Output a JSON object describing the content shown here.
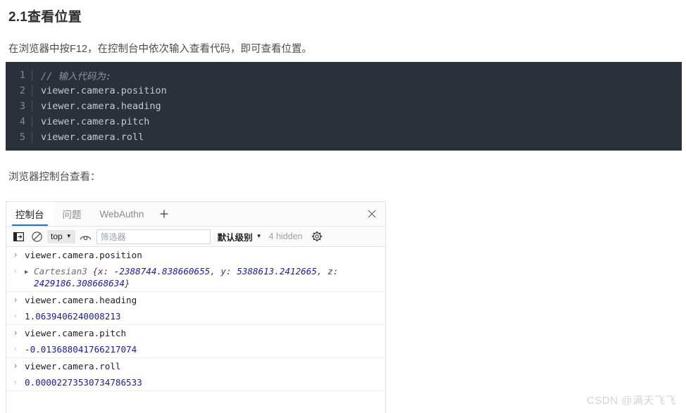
{
  "article": {
    "heading": "2.1查看位置",
    "intro": "在浏览器中按F12，在控制台中依次输入查看代码，即可查看位置。",
    "caption": "浏览器控制台查看："
  },
  "code_block": {
    "lines": [
      {
        "no": "1",
        "text": "// 输入代码为:",
        "comment": true
      },
      {
        "no": "2",
        "text": "viewer.camera.position",
        "comment": false
      },
      {
        "no": "3",
        "text": "viewer.camera.heading",
        "comment": false
      },
      {
        "no": "4",
        "text": "viewer.camera.pitch",
        "comment": false
      },
      {
        "no": "5",
        "text": "viewer.camera.roll",
        "comment": false
      }
    ]
  },
  "devtools": {
    "tabs": [
      {
        "label": "控制台",
        "active": true
      },
      {
        "label": "问题",
        "active": false
      },
      {
        "label": "WebAuthn",
        "active": false
      }
    ],
    "add_tab_label": "+",
    "close_label": "close-panel",
    "toolbar": {
      "sidebar_icon": "sidebar-toggle-icon",
      "clear_icon": "clear-console-icon",
      "context": "top",
      "context_caret": "▼",
      "eye_icon": "live-expression-icon",
      "filter_placeholder": "筛选器",
      "level": "默认级别",
      "level_caret": "▼",
      "hidden": "4 hidden",
      "settings_icon": "settings-gear-icon"
    },
    "rows": [
      {
        "type": "input",
        "marker": "›",
        "text": "viewer.camera.position"
      },
      {
        "type": "object",
        "marker": "‹",
        "triangle": "▶",
        "class_name": "Cartesian3",
        "open": " {",
        "k1": "x",
        "v1": "-2388744.838660655",
        "k2": "y",
        "v2": "5388613.2412665",
        "k3": "z",
        "v3": "2429186.308668634",
        "close": "}"
      },
      {
        "type": "input",
        "marker": "›",
        "text": "viewer.camera.heading"
      },
      {
        "type": "output",
        "marker": "‹",
        "text": "1.0639406240008213"
      },
      {
        "type": "input",
        "marker": "›",
        "text": "viewer.camera.pitch"
      },
      {
        "type": "output",
        "marker": "‹",
        "text": "-0.013688041766217074"
      },
      {
        "type": "input",
        "marker": "›",
        "text": "viewer.camera.roll"
      },
      {
        "type": "output",
        "marker": "‹",
        "text": "0.00002273530734786533"
      }
    ]
  },
  "watermark": "CSDN @满天飞飞"
}
